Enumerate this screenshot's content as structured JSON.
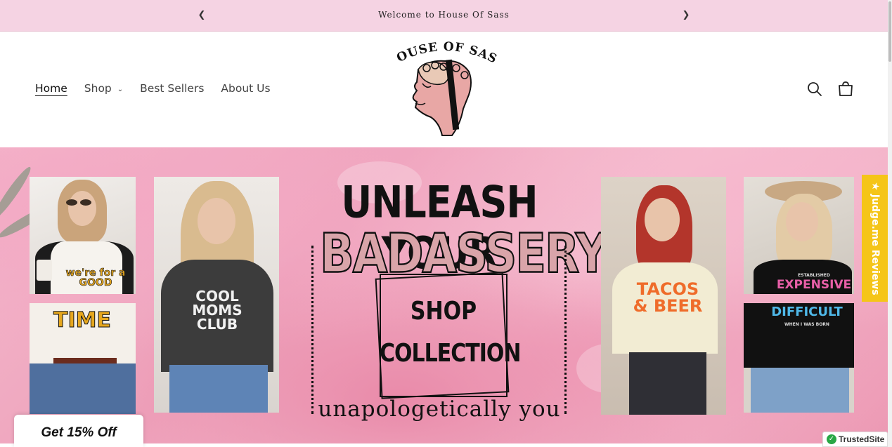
{
  "announcement": {
    "message": "Welcome to House Of Sass",
    "prev_icon": "chevron-left-icon",
    "next_icon": "chevron-right-icon"
  },
  "header": {
    "logo_text": "HOUSE OF SASS",
    "nav": [
      {
        "label": "Home",
        "active": true
      },
      {
        "label": "Shop",
        "has_dropdown": true
      },
      {
        "label": "Best Sellers"
      },
      {
        "label": "About Us"
      }
    ],
    "icons": [
      "search-icon",
      "cart-icon"
    ]
  },
  "hero": {
    "headline_line1": "UNLEASH YOUR",
    "headline_line2": "BADASSERY",
    "cta_line1": "SHOP",
    "cta_line2": "COLLECTION",
    "tagline": "unapologetically you",
    "shirt_texts": {
      "good_time_top": "we're for a GOOD",
      "good_time_bottom": "TIME",
      "cool_moms": "COOL MOMS CLUB",
      "tacos": "TACOS & BEER",
      "expensive_top": "ESTABLISHED",
      "expensive_mid": "EXPENSIVE",
      "expensive_bot": "DIFFICULT",
      "expensive_small": "WHEN I WAS BORN"
    }
  },
  "widgets": {
    "judgeme_label": "★ Judge.me Reviews",
    "discount_label": "Get 15% Off",
    "trusted_label": "TrustedSite"
  },
  "colors": {
    "announcement_bg": "#f5d3e3",
    "hero_pink": "#eea2bb",
    "headline_pink": "#d9a4a9",
    "judgeme_yellow": "#f5c518",
    "trusted_green": "#28a745"
  }
}
